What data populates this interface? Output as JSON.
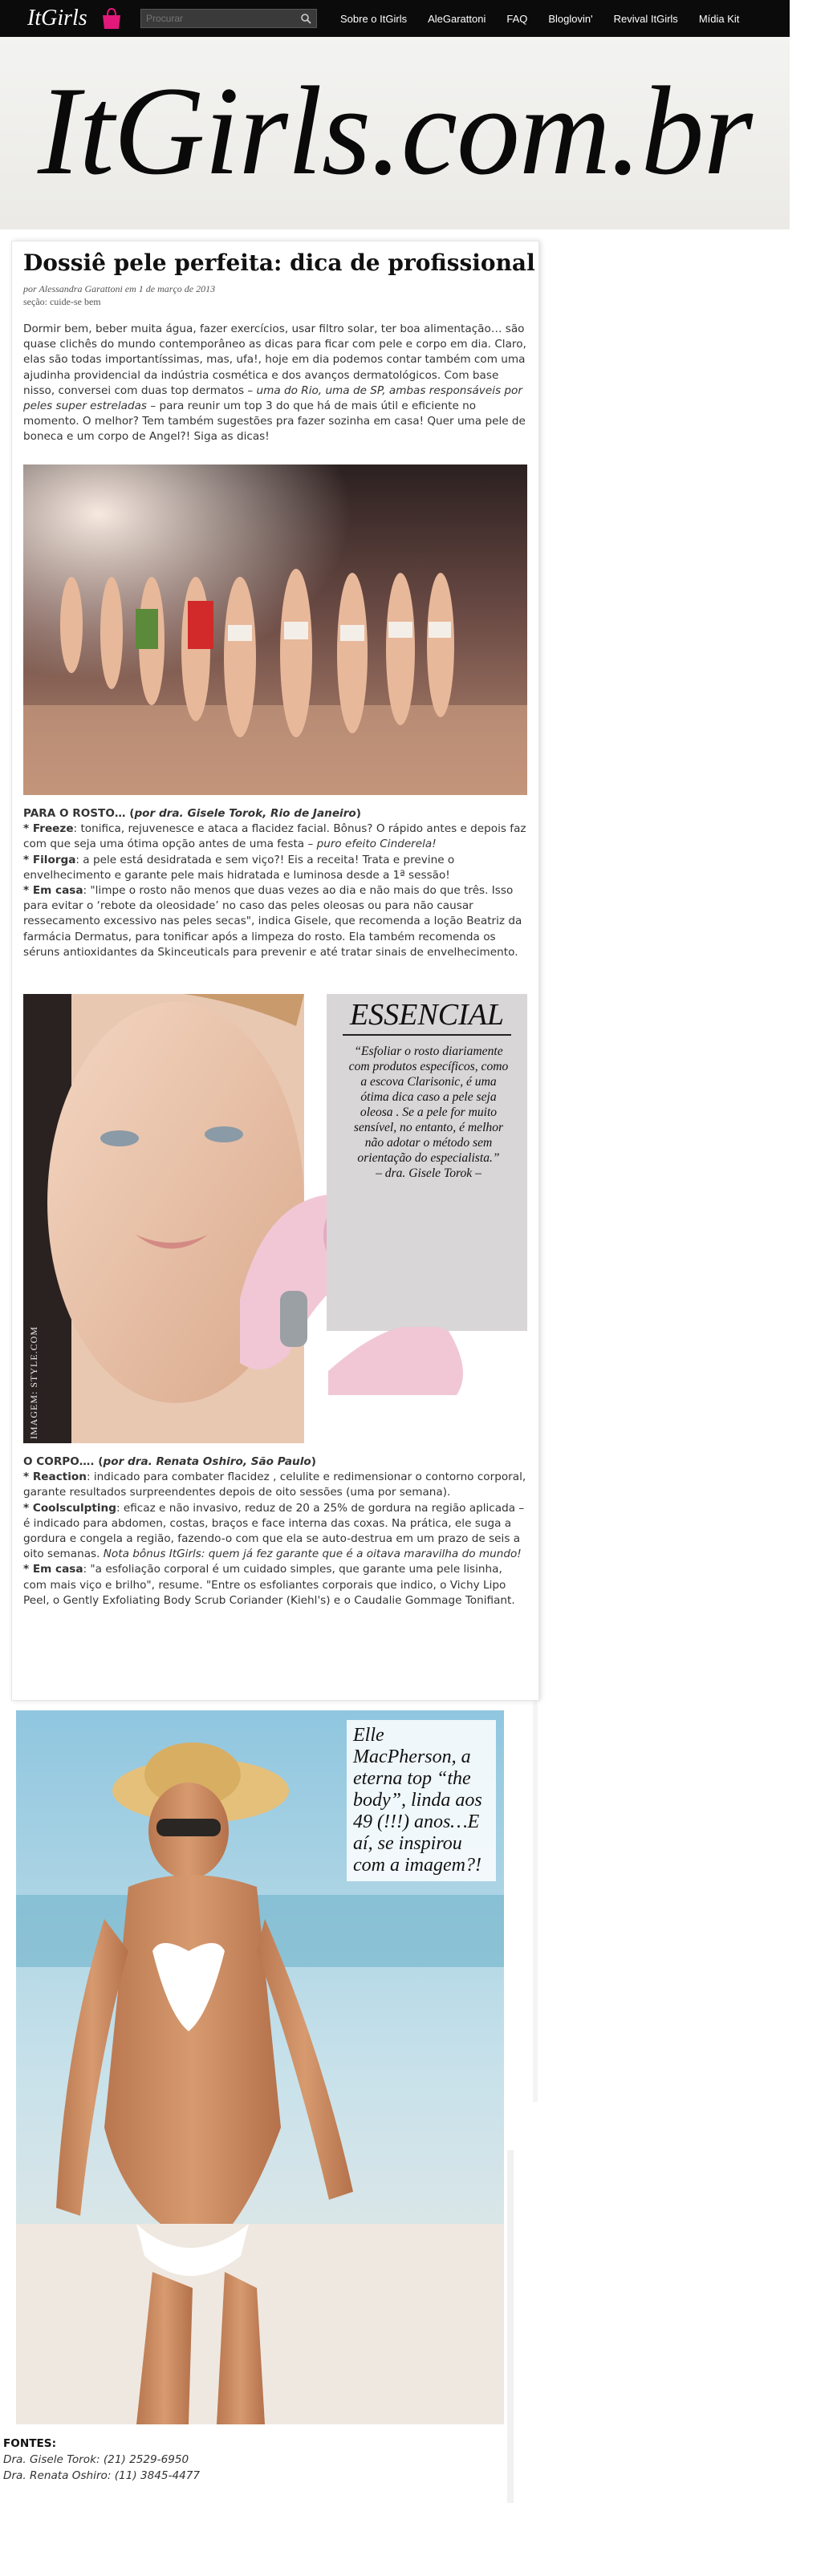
{
  "header": {
    "logo": "ItGirls",
    "search_placeholder": "Procurar",
    "nav": [
      "Sobre o ItGirls",
      "AleGarattoni",
      "FAQ",
      "Bloglovin'",
      "Revival ItGirls",
      "Mídia Kit"
    ]
  },
  "banner": {
    "title": "ItGirls.com.br"
  },
  "post": {
    "title": "Dossiê pele perfeita: dica de profissional",
    "byline": "por Alessandra Garattoni em 1 de março de 2013",
    "section": "seção: cuide-se bem",
    "intro": [
      {
        "t": "Dormir bem, beber muita água, fazer exercícios, usar filtro solar, ter boa alimentação… são quase clichês do mundo contemporâneo as dicas para ficar com pele e corpo em dia. Claro, elas são todas importantíssimas, mas, ufa!, hoje em dia podemos contar também com uma ajudinha providencial da indústria cosmética e dos avanços dermatológicos. Com base nisso, conversei com duas top dermatos – "
      },
      {
        "t": "uma do Rio, uma de SP, ambas responsáveis por peles super estreladas",
        "i": true
      },
      {
        "t": " – para reunir um top 3 do que há de mais útil e eficiente no momento. O melhor? Tem também sugestões pra fazer sozinha em casa! Quer uma pele de boneca e um corpo de Angel?! Siga as dicas!"
      }
    ],
    "rosto": [
      {
        "t": "PARA O ROSTO… (",
        "b": true
      },
      {
        "t": "por dra. Gisele Torok, Rio de Janeiro",
        "b": true,
        "i": true
      },
      {
        "t": ")",
        "b": true,
        "br": true
      },
      {
        "t": "* Freeze",
        "b": true
      },
      {
        "t": ": tonifica, rejuvenesce e ataca a flacidez facial. Bônus? O rápido antes e depois faz com que seja uma ótima opção antes de uma festa – "
      },
      {
        "t": "puro efeito Cinderela!",
        "i": true,
        "br": true
      },
      {
        "t": "* Filorga",
        "b": true
      },
      {
        "t": ": a pele está desidratada e sem viço?! Eis a receita! Trata e previne o envelhecimento e garante pele mais hidratada e luminosa desde a 1ª sessão!",
        "br": true
      },
      {
        "t": "* Em casa",
        "b": true
      },
      {
        "t": ": \"limpe o rosto não menos que duas vezes ao dia e não mais do que três. Isso para evitar o ‘rebote da oleosidade’ no caso das peles oleosas ou para não causar ressecamento excessivo nas peles secas\", indica Gisele, que recomenda a loção Beatriz da farmácia Dermatus, para tonificar após a limpeza do rosto. Ela também recomenda os séruns antioxidantes da Skinceuticals para prevenir e até tratar sinais de envelhecimento."
      }
    ],
    "essencial": {
      "title": "ESSENCIAL",
      "quote": "“Esfoliar o rosto diariamente com produtos específicos, como a escova Clarisonic, é uma ótima dica caso a pele seja oleosa . Se a pele for muito sensível, no entanto, é melhor não adotar o método sem orientação do especialista.”",
      "author": "– dra. Gisele Torok –",
      "credit": "IMAGEM: STYLE.COM"
    },
    "corpo": [
      {
        "t": "O CORPO…. (",
        "b": true
      },
      {
        "t": "por dra. Renata Oshiro, São Paulo",
        "b": true,
        "i": true
      },
      {
        "t": ")",
        "b": true,
        "br": true
      },
      {
        "t": "* Reaction",
        "b": true
      },
      {
        "t": ": indicado para combater flacidez , celulite e redimensionar o contorno corporal, garante resultados surpreendentes depois de oito sessões (uma por semana).",
        "br": true
      },
      {
        "t": "* Coolsculpting",
        "b": true
      },
      {
        "t": ": eficaz e não invasivo, reduz de 20 a 25% de gordura na região aplicada – é indicado para abdomen, costas, braços e face interna das coxas. Na prática, ele suga a gordura e congela a região, fazendo-o com que ela se auto-destrua em um prazo de seis a oito semanas. "
      },
      {
        "t": "Nota bônus ItGirls: quem já fez garante que é a oitava maravilha do mundo!",
        "i": true,
        "br": true
      },
      {
        "t": "* Em casa",
        "b": true
      },
      {
        "t": ": \"a esfoliação corporal é um cuidado simples, que garante uma pele lisinha, com mais viço e brilho\", resume. \"Entre os esfoliantes corporais que indico, o Vichy Lipo Peel, o Gently Exfoliating Body Scrub Coriander (Kiehl's) e o Caudalie Gommage Tonifiant."
      }
    ],
    "elle_caption": "Elle MacPherson, a eterna top “the body”, linda aos 49 (!!!) anos…E aí, se inspirou com a imagem?!",
    "sources": {
      "head": "FONTES:",
      "items": [
        "Dra. Gisele Torok: (21) 2529-6950",
        "Dra. Renata Oshiro: (11) 3845-4477"
      ]
    }
  }
}
